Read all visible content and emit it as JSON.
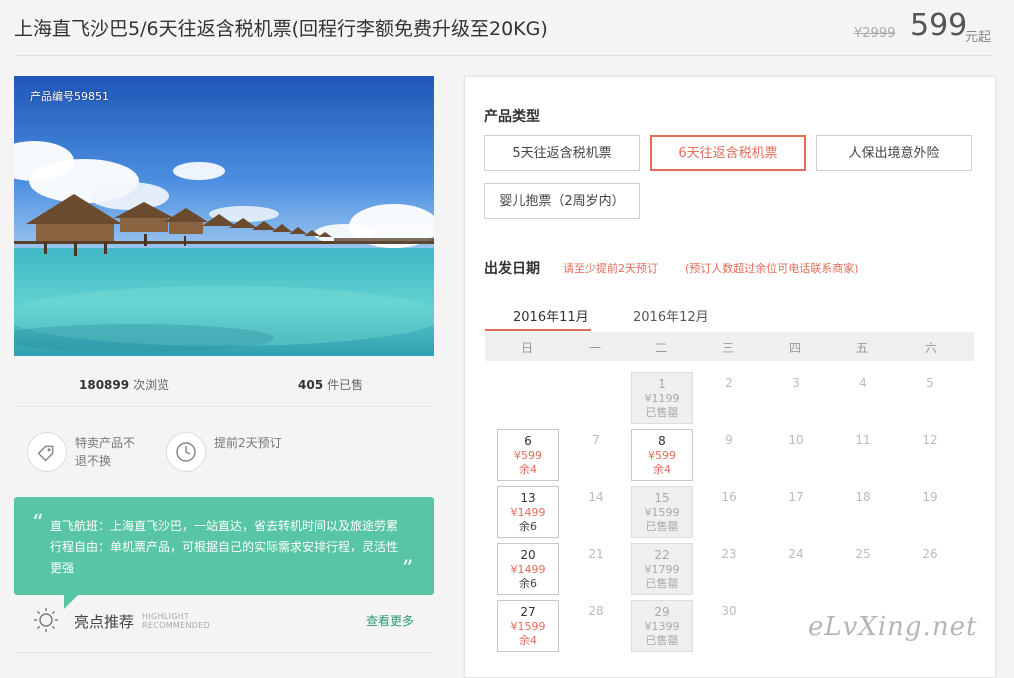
{
  "header": {
    "title": "上海直飞沙巴5/6天往返含税机票(回程行李额免费升级至20KG)",
    "original_price": "¥2999",
    "price": "599",
    "price_unit": "元起"
  },
  "photo": {
    "product_id": "产品编号59851"
  },
  "stats": {
    "views_count": "180899",
    "views_label": "次浏览",
    "sold_count": "405",
    "sold_label": "件已售"
  },
  "features": [
    {
      "icon": "tag-icon",
      "text": "特卖产品不退不换"
    },
    {
      "icon": "clock-icon",
      "text": "提前2天预订"
    }
  ],
  "quote": {
    "line1": "直飞航班：上海直飞沙巴，一站直达，省去转机时间以及旅途劳累",
    "line2": "行程自由：单机票产品，可根据自己的实际需求安排行程，灵活性",
    "line3": "更强"
  },
  "highlight": {
    "title": "亮点推荐",
    "en_line1": "HIGHLIGHT",
    "en_line2": "RECOMMENDED",
    "more": "查看更多"
  },
  "panel": {
    "type_label": "产品类型",
    "options": [
      "5天往返含税机票",
      "6天往返含税机票",
      "人保出境意外险",
      "婴儿抱票（2周岁内）"
    ],
    "active_option": "6天往返含税机票",
    "date_label": "出发日期",
    "note1": "请至少提前2天预订",
    "note2": "(预订人数超过余位可电话联系商家)",
    "months": [
      "2016年11月",
      "2016年12月"
    ],
    "active_month": "2016年11月",
    "weekdays": [
      "日",
      "一",
      "二",
      "三",
      "四",
      "五",
      "六"
    ],
    "calendar": {
      "d1": {
        "day": "1",
        "price": "¥1199",
        "remain": "已售罄"
      },
      "d2": "2",
      "d3": "3",
      "d4": "4",
      "d5": "5",
      "d6": {
        "day": "6",
        "price": "¥599",
        "remain": "余4"
      },
      "d7": "7",
      "d8": {
        "day": "8",
        "price": "¥599",
        "remain": "余4"
      },
      "d9": "9",
      "d10": "10",
      "d11": "11",
      "d12": "12",
      "d13": {
        "day": "13",
        "price": "¥1499",
        "remain": "余6"
      },
      "d14": "14",
      "d15": {
        "day": "15",
        "price": "¥1599",
        "remain": "已售罄"
      },
      "d16": "16",
      "d17": "17",
      "d18": "18",
      "d19": "19",
      "d20": {
        "day": "20",
        "price": "¥1499",
        "remain": "余6"
      },
      "d21": "21",
      "d22": {
        "day": "22",
        "price": "¥1799",
        "remain": "已售罄"
      },
      "d23": "23",
      "d24": "24",
      "d25": "25",
      "d26": "26",
      "d27": {
        "day": "27",
        "price": "¥1599",
        "remain": "余4"
      },
      "d28": "28",
      "d29": {
        "day": "29",
        "price": "¥1399",
        "remain": "已售罄"
      },
      "d30": "30"
    }
  },
  "watermark": "eLvXing.net",
  "colors": {
    "accent": "#e36c5a",
    "green": "#58c5a4",
    "link_green": "#2a9b76"
  }
}
